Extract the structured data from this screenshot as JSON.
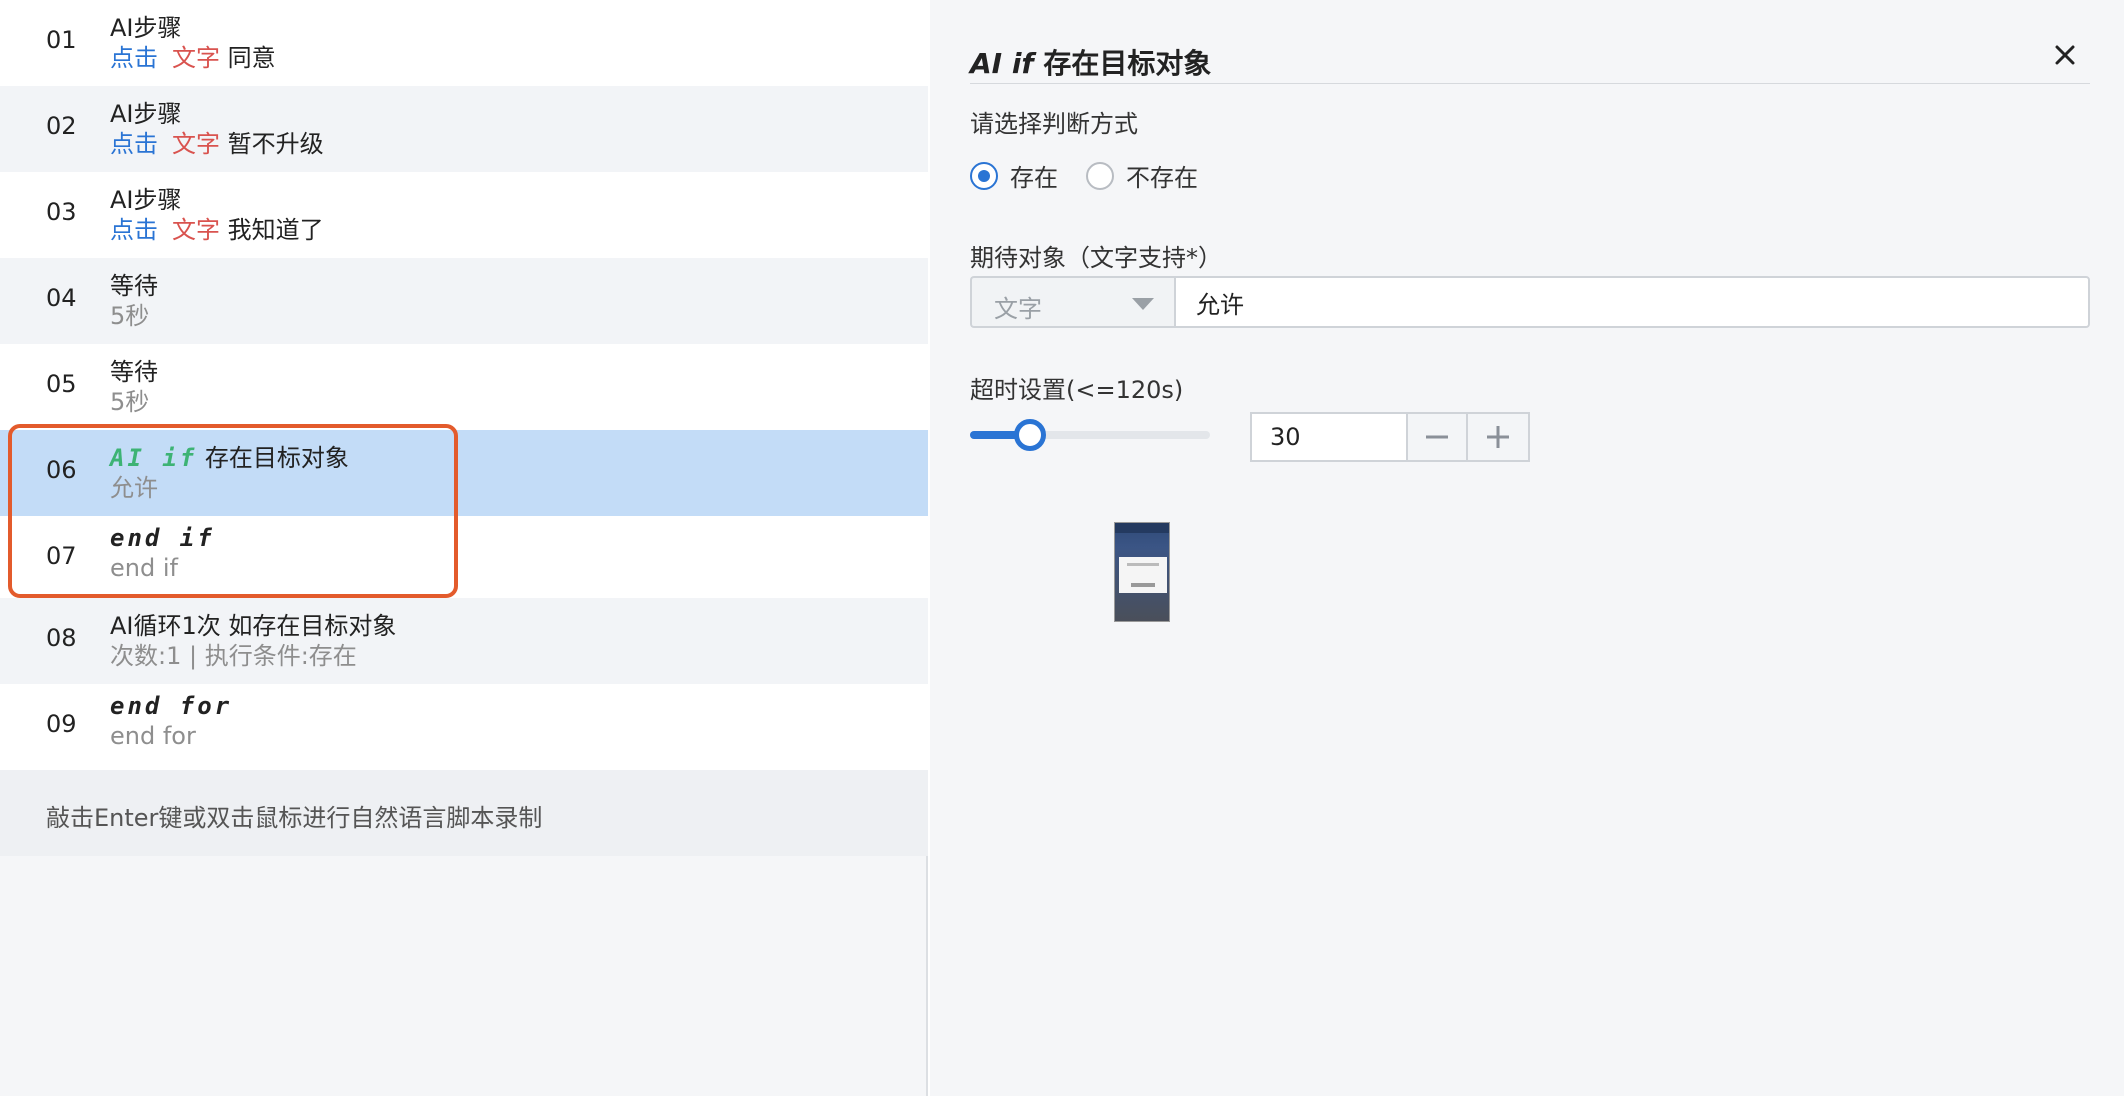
{
  "steps": [
    {
      "num": "01",
      "title": "AI步骤",
      "action": "点击",
      "type": "文字",
      "target": "同意"
    },
    {
      "num": "02",
      "title": "AI步骤",
      "action": "点击",
      "type": "文字",
      "target": "暂不升级"
    },
    {
      "num": "03",
      "title": "AI步骤",
      "action": "点击",
      "type": "文字",
      "target": "我知道了"
    },
    {
      "num": "04",
      "title": "等待",
      "sub": "5秒"
    },
    {
      "num": "05",
      "title": "等待",
      "sub": "5秒"
    },
    {
      "num": "06",
      "keyword": "AI if",
      "title": "存在目标对象",
      "sub": "允许"
    },
    {
      "num": "07",
      "keyword": "end if",
      "sub": "end if"
    },
    {
      "num": "08",
      "title": "AI循环1次 如存在目标对象",
      "sub": "次数:1 | 执行条件:存在"
    },
    {
      "num": "09",
      "keyword": "end for",
      "sub": "end for"
    }
  ],
  "hint": "敲击Enter键或双击鼠标进行自然语言脚本录制",
  "panel": {
    "title_keyword": "AI if",
    "title_text": "存在目标对象",
    "judge_label": "请选择判断方式",
    "radio_exists": "存在",
    "radio_not_exists": "不存在",
    "selected_radio": "存在",
    "expect_label": "期待对象（文字支持*）",
    "type_select": "文字",
    "expect_value": "允许",
    "timeout_label": "超时设置(<=120s)",
    "timeout_value": "30",
    "timeout_max": 120
  },
  "colors": {
    "accent": "#2a74d4",
    "action_blue": "#2a74d4",
    "type_red": "#d9534f",
    "keyword_green": "#3db374",
    "selected_row": "#c3dcf7",
    "highlight_box": "#e35b2c"
  }
}
